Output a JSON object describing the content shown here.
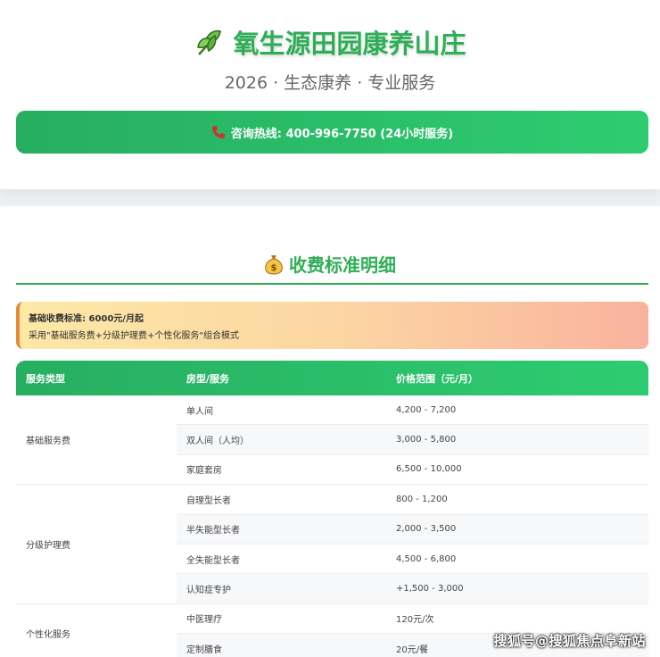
{
  "header": {
    "title": "氧生源田园康养山庄",
    "subtitle": "2026 · 生态康养 · 专业服务",
    "hotline": "咨询热线: 400-996-7750 (24小时服务)",
    "leaf_icon": "leaf-icon",
    "phone_icon": "phone-icon"
  },
  "pricing": {
    "section_title": "收费标准明细",
    "section_icon": "money-bag-icon",
    "notice_line1": "基础收费标准: 6000元/月起",
    "notice_line2": "采用\"基础服务费+分级护理费+个性化服务\"组合模式",
    "table": {
      "headers": [
        "服务类型",
        "房型/服务",
        "价格范围（元/月）"
      ],
      "groups": [
        {
          "type": "基础服务费",
          "rows": [
            {
              "service": "单人间",
              "price": "4,200 - 7,200"
            },
            {
              "service": "双人间（人均）",
              "price": "3,000 - 5,800"
            },
            {
              "service": "家庭套房",
              "price": "6,500 - 10,000"
            }
          ]
        },
        {
          "type": "分级护理费",
          "rows": [
            {
              "service": "自理型长者",
              "price": "800 - 1,200"
            },
            {
              "service": "半失能型长者",
              "price": "2,000 - 3,500"
            },
            {
              "service": "全失能型长者",
              "price": "4,500 - 6,800"
            },
            {
              "service": "认知症专护",
              "price": "+1,500 - 3,000"
            }
          ]
        },
        {
          "type": "个性化服务",
          "rows": [
            {
              "service": "中医理疗",
              "price": "120元/次"
            },
            {
              "service": "定制膳食",
              "price": "20元/餐"
            }
          ]
        }
      ]
    }
  },
  "watermark": "搜狐号@搜狐焦点阜新站",
  "colors": {
    "brand_green": "#2eae56",
    "header_gradient_start": "#27ae60",
    "header_gradient_end": "#2ecc71"
  }
}
